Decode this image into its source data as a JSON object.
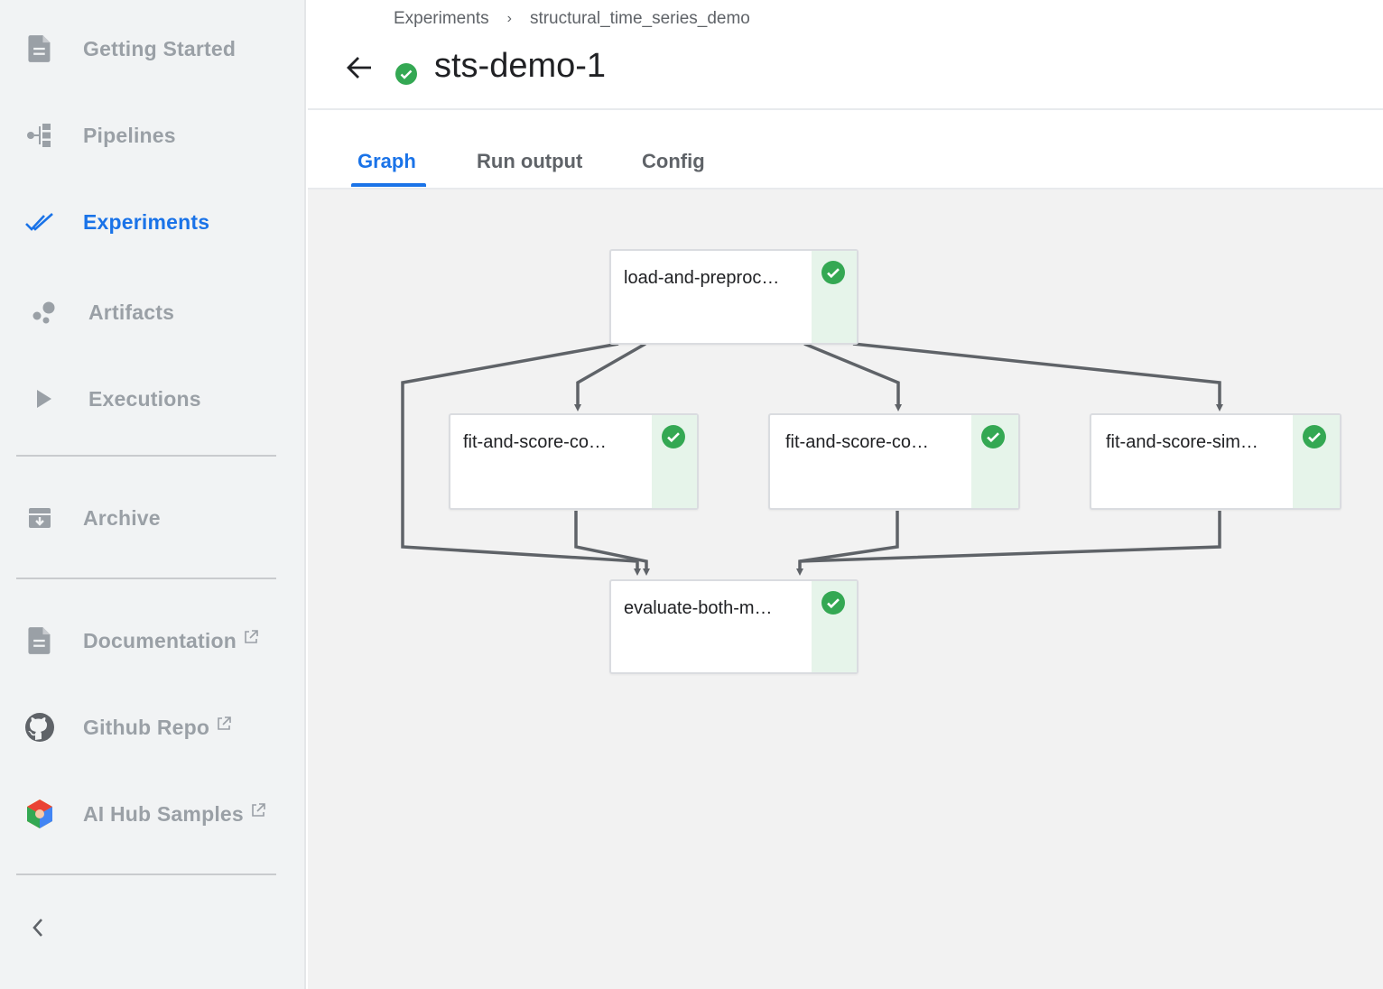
{
  "sidebar": {
    "items": [
      {
        "id": "getting-started",
        "label": "Getting Started",
        "icon": "document-icon"
      },
      {
        "id": "pipelines",
        "label": "Pipelines",
        "icon": "pipeline-icon"
      },
      {
        "id": "experiments",
        "label": "Experiments",
        "icon": "double-check-icon",
        "active": true
      },
      {
        "id": "artifacts",
        "label": "Artifacts",
        "icon": "bubbles-icon"
      },
      {
        "id": "executions",
        "label": "Executions",
        "icon": "play-icon"
      },
      {
        "id": "archive",
        "label": "Archive",
        "icon": "archive-icon"
      },
      {
        "id": "documentation",
        "label": "Documentation",
        "icon": "document-icon",
        "external": true
      },
      {
        "id": "github-repo",
        "label": "Github Repo",
        "icon": "github-icon",
        "external": true
      },
      {
        "id": "ai-hub-samples",
        "label": "AI Hub Samples",
        "icon": "ai-hub-icon",
        "external": true
      }
    ],
    "collapse_icon": "chevron-left-icon"
  },
  "header": {
    "breadcrumb": [
      "Experiments",
      "structural_time_series_demo"
    ],
    "title": "sts-demo-1",
    "status": "succeeded"
  },
  "tabs": [
    {
      "label": "Graph",
      "active": true
    },
    {
      "label": "Run output"
    },
    {
      "label": "Config"
    }
  ],
  "graph": {
    "nodes": [
      {
        "id": "load",
        "label": "load-and-preproc…",
        "status": "succeeded"
      },
      {
        "id": "fit1",
        "label": "fit-and-score-co…",
        "status": "succeeded"
      },
      {
        "id": "fit2",
        "label": "fit-and-score-co…",
        "status": "succeeded"
      },
      {
        "id": "fit3",
        "label": "fit-and-score-sim…",
        "status": "succeeded"
      },
      {
        "id": "eval",
        "label": "evaluate-both-m…",
        "status": "succeeded"
      }
    ]
  },
  "colors": {
    "accent": "#1a73e8",
    "success": "#34a853",
    "success_bg": "#e6f4ea",
    "edge": "#5f6368"
  }
}
